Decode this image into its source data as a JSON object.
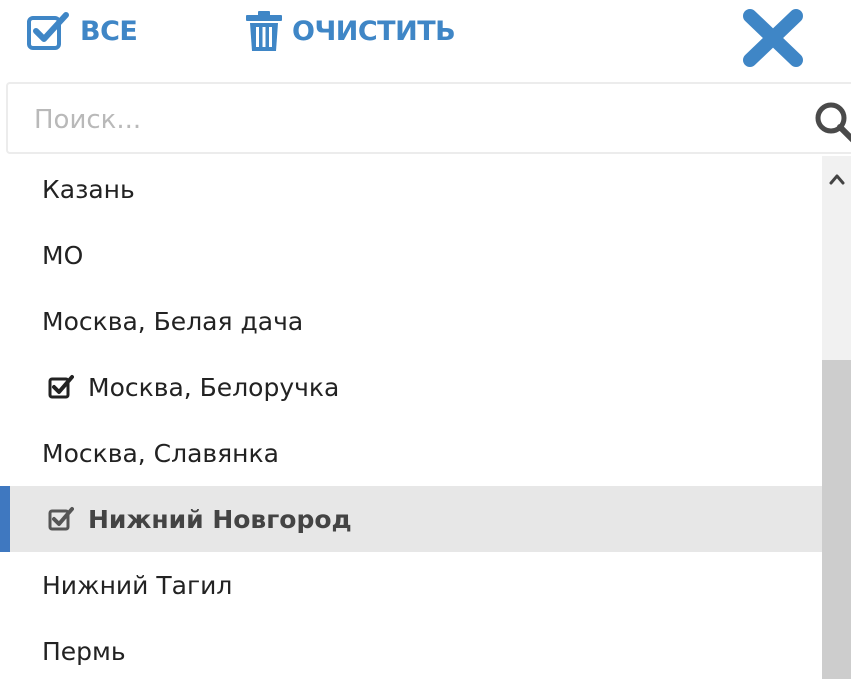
{
  "toolbar": {
    "all_label": "ВСЕ",
    "clear_label": "ОЧИСТИТЬ"
  },
  "search": {
    "placeholder": "Поиск..."
  },
  "list": {
    "items": [
      {
        "label": "Казань",
        "checked": false,
        "highlighted": false
      },
      {
        "label": "МО",
        "checked": false,
        "highlighted": false
      },
      {
        "label": "Москва, Белая дача",
        "checked": false,
        "highlighted": false
      },
      {
        "label": "Москва, Белоручка",
        "checked": true,
        "highlighted": false
      },
      {
        "label": "Москва, Славянка",
        "checked": false,
        "highlighted": false
      },
      {
        "label": "Нижний Новгород",
        "checked": true,
        "highlighted": true
      },
      {
        "label": "Нижний Тагил",
        "checked": false,
        "highlighted": false
      },
      {
        "label": "Пермь",
        "checked": false,
        "highlighted": false
      }
    ]
  },
  "colors": {
    "accent": "#3f86c6",
    "highlight_bg": "#e7e7e7",
    "highlight_border": "#3f78c0",
    "text": "#222222",
    "placeholder": "#b9b9b9"
  },
  "icons": {
    "all": "checkbox-edit-icon",
    "clear": "trash-icon",
    "close": "close-icon",
    "search": "search-icon",
    "checked_item": "checked-checkbox-icon",
    "scroll_up": "chevron-up-icon"
  }
}
